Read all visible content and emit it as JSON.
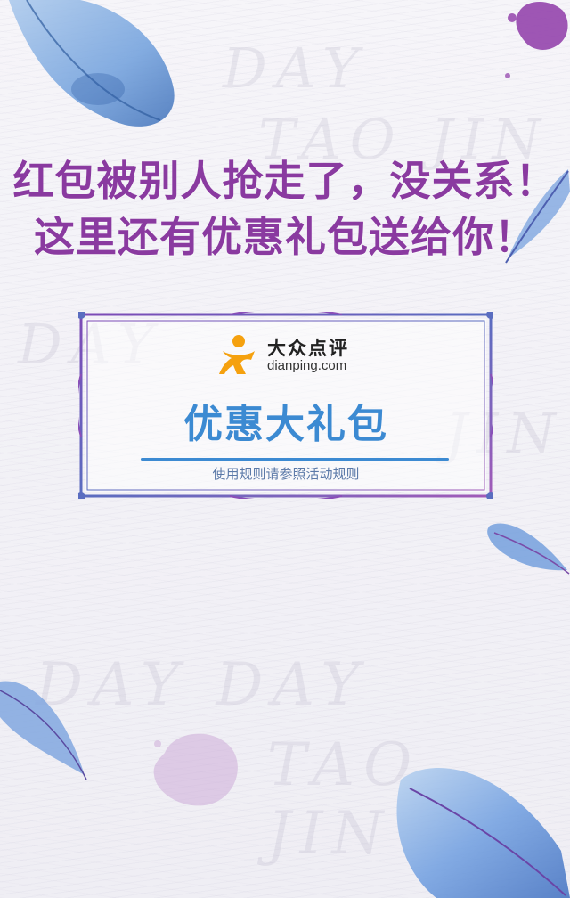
{
  "headline": {
    "line1": "红包被别人抢走了，没关系！",
    "line2": "这里还有优惠礼包送给你！"
  },
  "brand": {
    "name_cn": "大众点评",
    "domain": "dianping.com",
    "icon": "dianping-person-icon",
    "color": "#f5a10f"
  },
  "card": {
    "title": "优惠大礼包",
    "note": "使用规则请参照活动规则"
  },
  "colors": {
    "headline_purple": "#8a3aa0",
    "title_blue": "#3c8ad2",
    "frame_purple": "#8a5fb8"
  },
  "decorations": {
    "watermark": [
      "DAY",
      "TAO JIN",
      "DAY",
      "JIN",
      "DAY DAY",
      "TAO JIN"
    ]
  }
}
